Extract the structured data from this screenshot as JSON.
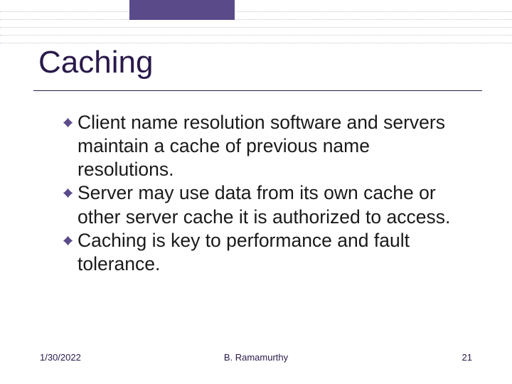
{
  "title": "Caching",
  "bullets": [
    "Client name resolution software and servers maintain a cache of previous name resolutions.",
    "Server may use data from its own cache or other server cache it is authorized to access.",
    "Caching is key to performance and fault tolerance."
  ],
  "footer": {
    "date": "1/30/2022",
    "author": "B. Ramamurthy",
    "page_number": "21"
  },
  "colors": {
    "accent_bar": "#5a4a8a",
    "title": "#2a1a4a",
    "dotted": "#c8c4d8"
  }
}
